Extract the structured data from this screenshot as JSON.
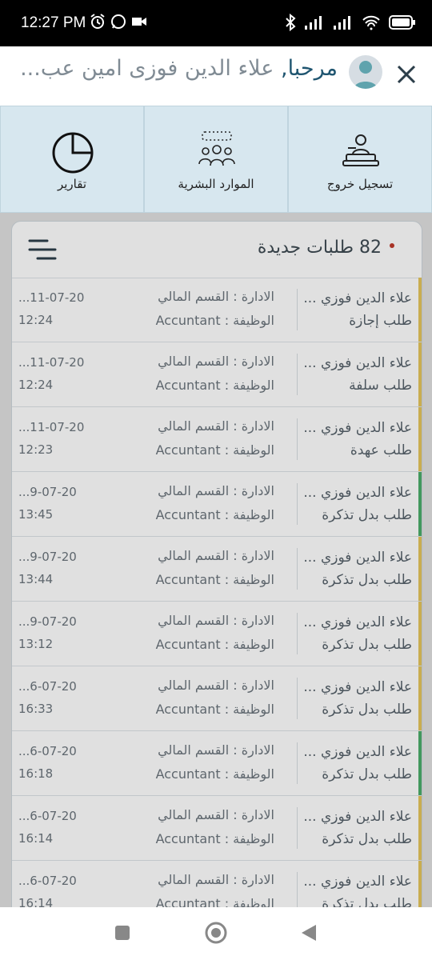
{
  "status_bar": {
    "time": "12:27 PM",
    "battery": "100"
  },
  "header": {
    "greeting": "مرحبا",
    "user_name": "علاء الدين فوزى امين عب...",
    "comma": ","
  },
  "shortcuts": [
    {
      "label": "تسجيل خروج",
      "icon": "logout-icon"
    },
    {
      "label": "الموارد البشرية",
      "icon": "hr-icon"
    },
    {
      "label": "تقارير",
      "icon": "reports-icon"
    }
  ],
  "requests": {
    "title": "82 طلبات جديدة",
    "rows": [
      {
        "name": "علاء الدين فوزي ...",
        "type": "طلب إجازة",
        "dept": "الادارة : القسم المالي",
        "job": "الوظيفة : Accuntant",
        "date": "...11-07-20",
        "time": "12:24",
        "status_color": "#e5c55c"
      },
      {
        "name": "علاء الدين فوزي ...",
        "type": "طلب سلفة",
        "dept": "الادارة : القسم المالي",
        "job": "الوظيفة : Accuntant",
        "date": "...11-07-20",
        "time": "12:24",
        "status_color": "#e5c55c"
      },
      {
        "name": "علاء الدين فوزي ...",
        "type": "طلب عهدة",
        "dept": "الادارة : القسم المالي",
        "job": "الوظيفة : Accuntant",
        "date": "...11-07-20",
        "time": "12:23",
        "status_color": "#e5c55c"
      },
      {
        "name": "علاء الدين فوزي ...",
        "type": "طلب بدل تذكرة",
        "dept": "الادارة : القسم المالي",
        "job": "الوظيفة : Accuntant",
        "date": "...9-07-20",
        "time": "13:45",
        "status_color": "#4cae6a"
      },
      {
        "name": "علاء الدين فوزي ...",
        "type": "طلب بدل تذكرة",
        "dept": "الادارة : القسم المالي",
        "job": "الوظيفة : Accuntant",
        "date": "...9-07-20",
        "time": "13:44",
        "status_color": "#e5c55c"
      },
      {
        "name": "علاء الدين فوزي ...",
        "type": "طلب بدل تذكرة",
        "dept": "الادارة : القسم المالي",
        "job": "الوظيفة : Accuntant",
        "date": "...9-07-20",
        "time": "13:12",
        "status_color": "#e5c55c"
      },
      {
        "name": "علاء الدين فوزي ...",
        "type": "طلب بدل تذكرة",
        "dept": "الادارة : القسم المالي",
        "job": "الوظيفة : Accuntant",
        "date": "...6-07-20",
        "time": "16:33",
        "status_color": "#e5c55c"
      },
      {
        "name": "علاء الدين فوزي ...",
        "type": "طلب بدل تذكرة",
        "dept": "الادارة : القسم المالي",
        "job": "الوظيفة : Accuntant",
        "date": "...6-07-20",
        "time": "16:18",
        "status_color": "#4cae6a"
      },
      {
        "name": "علاء الدين فوزي ...",
        "type": "طلب بدل تذكرة",
        "dept": "الادارة : القسم المالي",
        "job": "الوظيفة : Accuntant",
        "date": "...6-07-20",
        "time": "16:14",
        "status_color": "#e5c55c"
      },
      {
        "name": "علاء الدين فوزي ...",
        "type": "طلب بدل تذكرة",
        "dept": "الادارة : القسم المالي",
        "job": "الوظيفة : Accuntant",
        "date": "...6-07-20",
        "time": "16:14",
        "status_color": "#e5c55c"
      }
    ]
  }
}
